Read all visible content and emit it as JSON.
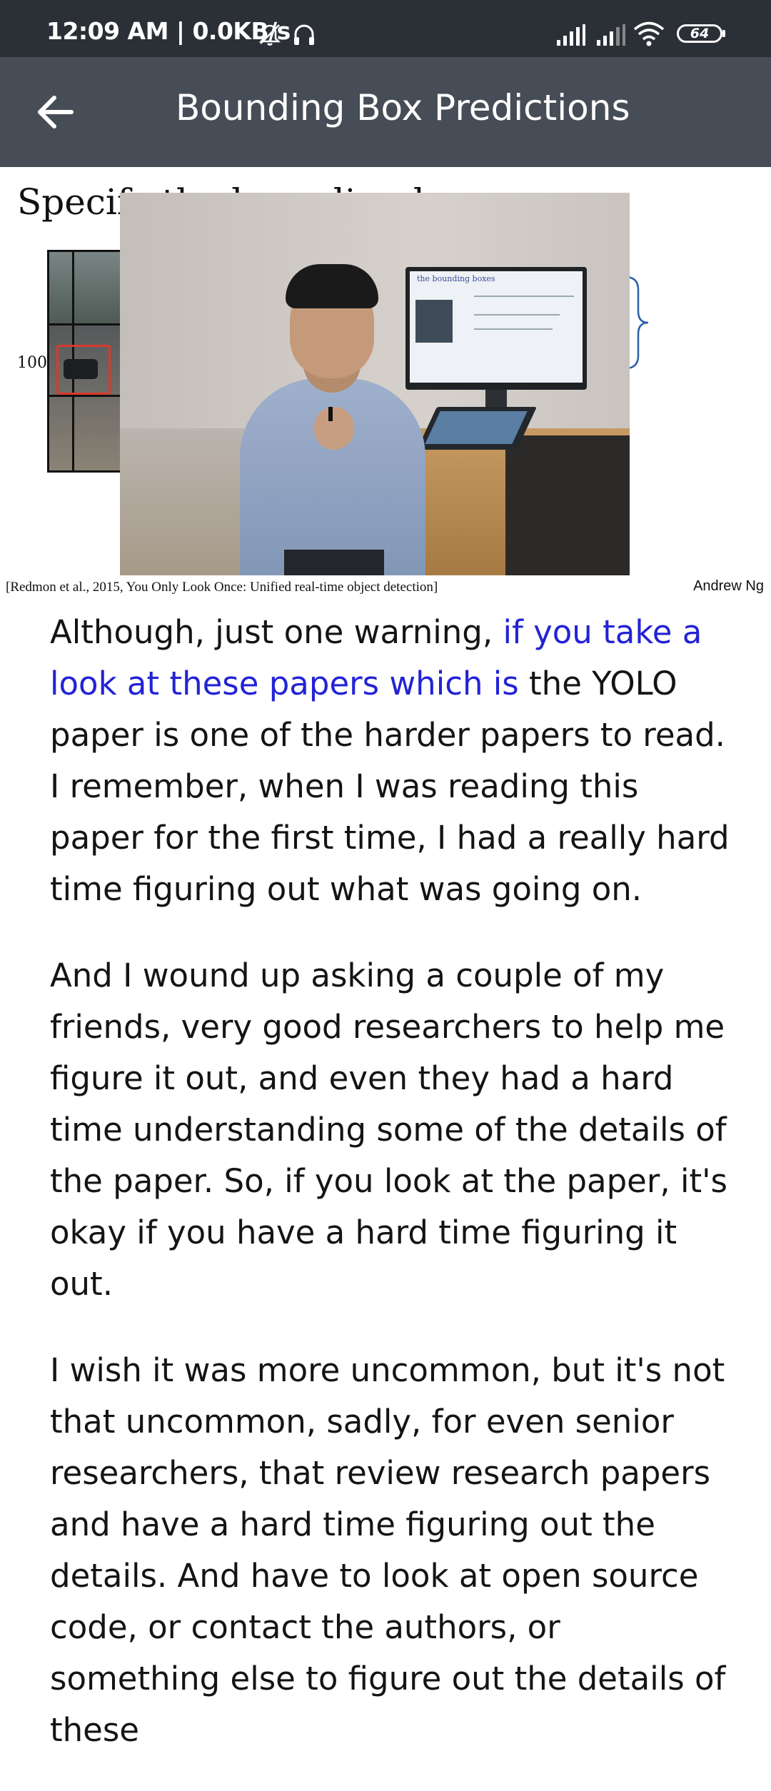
{
  "status_bar": {
    "time": "12:09 AM | 0.0KB/s",
    "battery": "64",
    "icons": [
      "mute-icon",
      "headphones-icon",
      "signal-icon",
      "signal-icon",
      "wifi-icon",
      "battery-icon"
    ]
  },
  "app_bar": {
    "title": "Bounding Box Predictions",
    "back_icon": "arrow-left-icon"
  },
  "slide": {
    "title": "Specify the bounding boxes",
    "axis_label": "100",
    "monitor_text": "the bounding boxes",
    "citation": "[Redmon et al., 2015, You Only Look Once: Unified real-time object detection]",
    "author": "Andrew Ng"
  },
  "transcript": {
    "p1_before": "Although, just one warning, ",
    "p1_highlight": "if you take a look at these papers which is",
    "p1_after": " the YOLO paper is one of the harder papers to read. I remember, when I was reading this paper for the first time, I had a really hard time figuring out what was going on.",
    "p2": "And I wound up asking a couple of my friends, very good researchers to help me figure it out, and even they had a hard time understanding some of the details of the paper. So, if you look at the paper, it's okay if you have a hard time figuring it out.",
    "p3": "I wish it was more uncommon, but it's not that uncommon, sadly, for even senior researchers, that review research papers and have a hard time figuring out the details. And have to look at open source code, or contact the authors, or something else to figure out the details of these"
  },
  "colors": {
    "status_bar_bg": "#2b2f36",
    "app_bar_bg": "#474d57",
    "highlight_text": "#2323d6"
  }
}
